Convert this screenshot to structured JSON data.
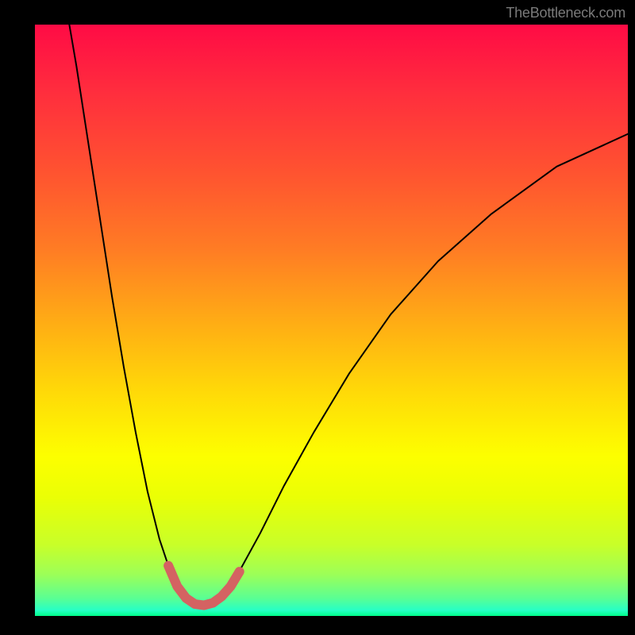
{
  "watermark": "TheBottleneck.com",
  "chart_data": {
    "type": "line",
    "title": "",
    "xlabel": "",
    "ylabel": "",
    "xlim": [
      0,
      100
    ],
    "ylim": [
      0,
      1
    ],
    "gradient_stops": [
      {
        "pos": 0.0,
        "color": "#ff0b45"
      },
      {
        "pos": 0.12,
        "color": "#ff2f3d"
      },
      {
        "pos": 0.25,
        "color": "#ff5330"
      },
      {
        "pos": 0.38,
        "color": "#ff7c24"
      },
      {
        "pos": 0.5,
        "color": "#ffab15"
      },
      {
        "pos": 0.62,
        "color": "#ffd908"
      },
      {
        "pos": 0.73,
        "color": "#fdff00"
      },
      {
        "pos": 0.8,
        "color": "#eaff05"
      },
      {
        "pos": 0.88,
        "color": "#c8ff29"
      },
      {
        "pos": 0.93,
        "color": "#9cff58"
      },
      {
        "pos": 0.97,
        "color": "#5aff93"
      },
      {
        "pos": 0.99,
        "color": "#27ffc5"
      },
      {
        "pos": 1.0,
        "color": "#00ff8a"
      }
    ],
    "series": [
      {
        "name": "bottleneck-curve",
        "color": "#000000",
        "stroke_width": 2,
        "points": [
          {
            "x": 5.8,
            "y": 1.0
          },
          {
            "x": 7.0,
            "y": 0.93
          },
          {
            "x": 9.0,
            "y": 0.8
          },
          {
            "x": 11.0,
            "y": 0.67
          },
          {
            "x": 13.0,
            "y": 0.54
          },
          {
            "x": 15.0,
            "y": 0.42
          },
          {
            "x": 17.0,
            "y": 0.31
          },
          {
            "x": 19.0,
            "y": 0.21
          },
          {
            "x": 21.0,
            "y": 0.13
          },
          {
            "x": 22.5,
            "y": 0.085
          },
          {
            "x": 24.0,
            "y": 0.05
          },
          {
            "x": 25.5,
            "y": 0.03
          },
          {
            "x": 27.0,
            "y": 0.02
          },
          {
            "x": 28.5,
            "y": 0.018
          },
          {
            "x": 30.0,
            "y": 0.022
          },
          {
            "x": 31.5,
            "y": 0.033
          },
          {
            "x": 33.0,
            "y": 0.05
          },
          {
            "x": 35.0,
            "y": 0.085
          },
          {
            "x": 38.0,
            "y": 0.14
          },
          {
            "x": 42.0,
            "y": 0.22
          },
          {
            "x": 47.0,
            "y": 0.31
          },
          {
            "x": 53.0,
            "y": 0.41
          },
          {
            "x": 60.0,
            "y": 0.51
          },
          {
            "x": 68.0,
            "y": 0.6
          },
          {
            "x": 77.0,
            "y": 0.68
          },
          {
            "x": 88.0,
            "y": 0.76
          },
          {
            "x": 100.0,
            "y": 0.815
          }
        ]
      },
      {
        "name": "valley-highlight",
        "color": "#d46262",
        "stroke_width": 12,
        "points": [
          {
            "x": 22.5,
            "y": 0.085
          },
          {
            "x": 24.0,
            "y": 0.05
          },
          {
            "x": 25.5,
            "y": 0.03
          },
          {
            "x": 27.0,
            "y": 0.02
          },
          {
            "x": 28.5,
            "y": 0.018
          },
          {
            "x": 30.0,
            "y": 0.022
          },
          {
            "x": 31.5,
            "y": 0.033
          },
          {
            "x": 33.0,
            "y": 0.05
          },
          {
            "x": 34.5,
            "y": 0.075
          }
        ]
      }
    ]
  }
}
